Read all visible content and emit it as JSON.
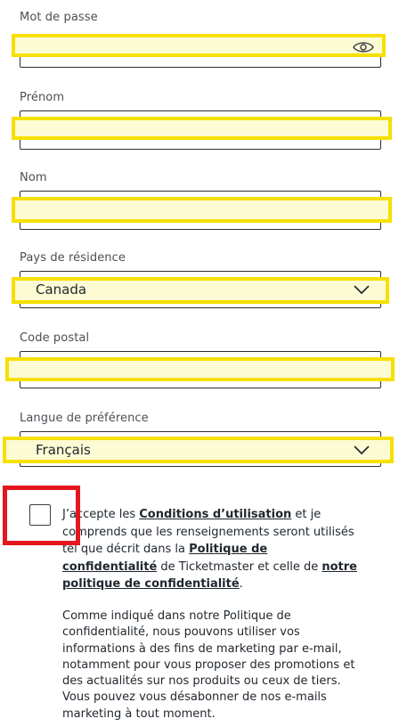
{
  "form": {
    "password": {
      "label": "Mot de passe",
      "value": ""
    },
    "first_name": {
      "label": "Prénom",
      "value": ""
    },
    "last_name": {
      "label": "Nom",
      "value": ""
    },
    "country": {
      "label": "Pays de résidence",
      "value": "Canada"
    },
    "postal_code": {
      "label": "Code postal",
      "value": ""
    },
    "language": {
      "label": "Langue de préférence",
      "value": "Français"
    }
  },
  "consent": {
    "checked": false,
    "text_1": "J’accepte les ",
    "terms_link": "Conditions d’utilisation",
    "text_2": " et je comprends que les renseignements seront utilisés tel que décrit dans la ",
    "privacy_link": "Politique de confidentialité",
    "text_3": " de Ticketmaster et celle de ",
    "our_policy_link": "notre politique de confidentialité",
    "text_4": "."
  },
  "marketing_notice": "Comme indiqué dans notre Politique de confidentialité, nous pouvons utiliser vos informations à des fins de marketing par e-mail, notamment pour vous proposer des promotions et des actualités sur nos produits ou ceux de tiers. Vous pouvez vous désabonner de nos e-mails marketing à tout moment.",
  "colors": {
    "highlight": "#f6e000",
    "highlight_fill": "#fdfbd4",
    "annotation_red": "#e4161e"
  },
  "icons": {
    "password_toggle": "eye-icon",
    "dropdown": "chevron-down-icon"
  }
}
